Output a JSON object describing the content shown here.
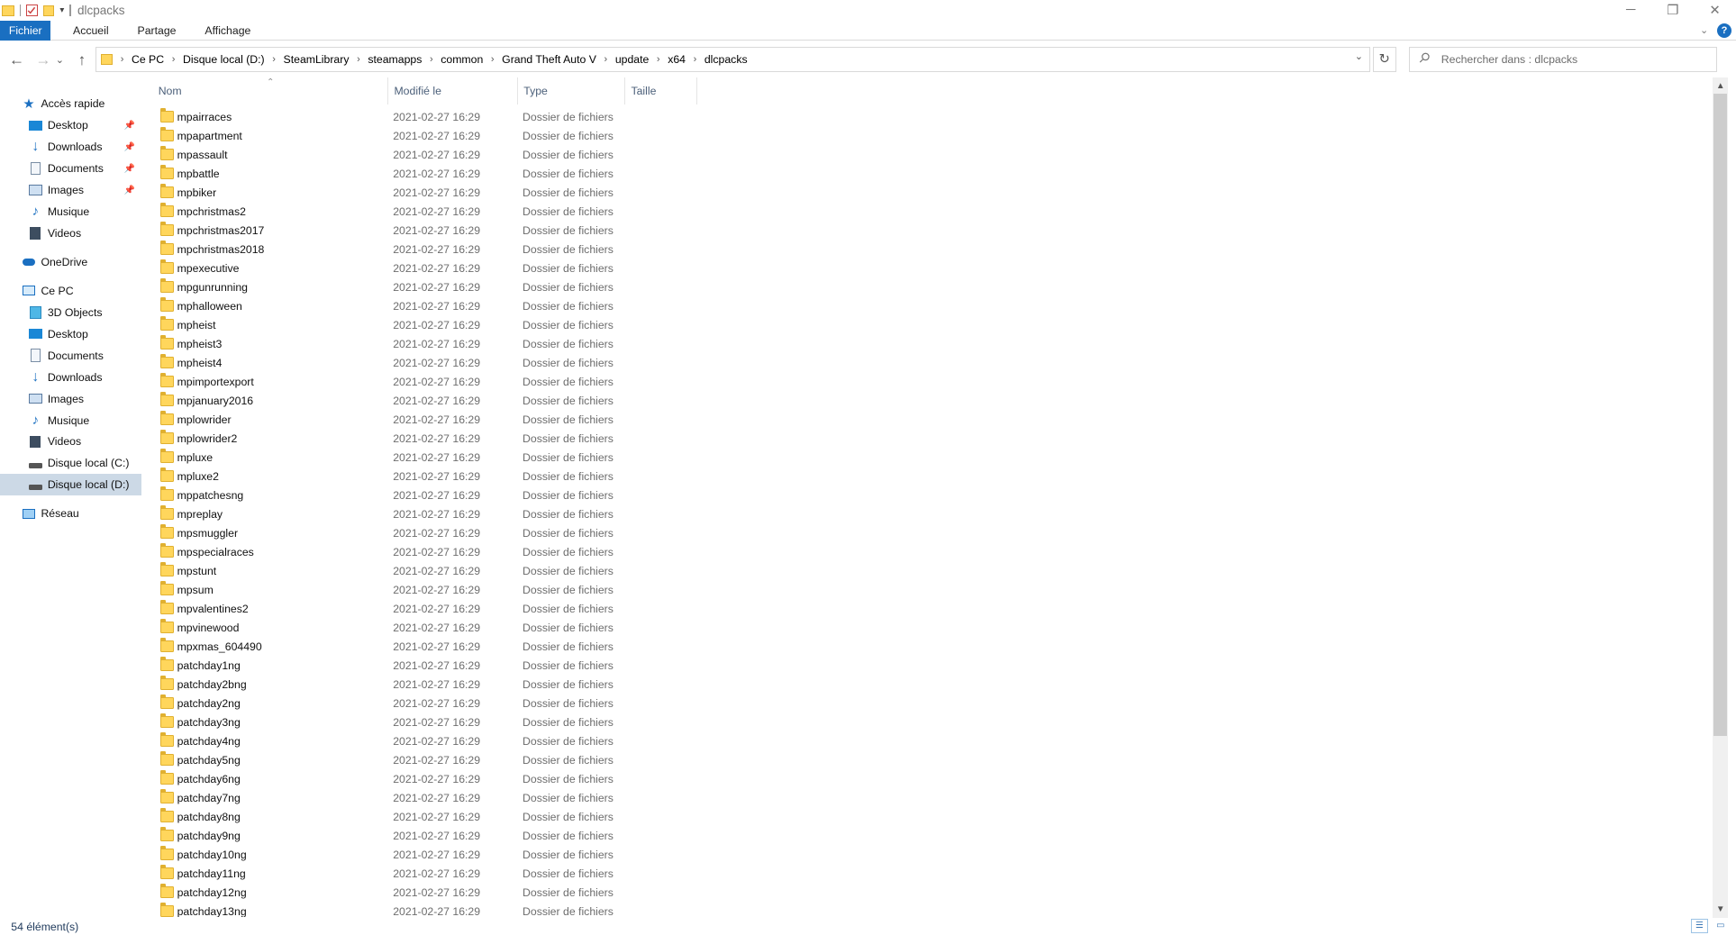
{
  "window": {
    "title": "dlcpacks",
    "minimize_icon": "minimize-icon",
    "maximize_icon": "restore-icon",
    "close_icon": "close-icon"
  },
  "ribbon": {
    "tabs": [
      "Fichier",
      "Accueil",
      "Partage",
      "Affichage"
    ],
    "help": "?"
  },
  "address": {
    "crumbs": [
      "Ce PC",
      "Disque local (D:)",
      "SteamLibrary",
      "steamapps",
      "common",
      "Grand Theft Auto V",
      "update",
      "x64",
      "dlcpacks"
    ]
  },
  "search": {
    "placeholder": "Rechercher dans : dlcpacks"
  },
  "sidebar": {
    "quick_access": "Accès rapide",
    "quick_items": [
      "Desktop",
      "Downloads",
      "Documents",
      "Images",
      "Musique",
      "Videos"
    ],
    "onedrive": "OneDrive",
    "this_pc": "Ce PC",
    "pc_items": [
      "3D Objects",
      "Desktop",
      "Documents",
      "Downloads",
      "Images",
      "Musique",
      "Videos",
      "Disque local (C:)",
      "Disque local (D:)"
    ],
    "network": "Réseau"
  },
  "columns": {
    "name": "Nom",
    "modified": "Modifié le",
    "type": "Type",
    "size": "Taille"
  },
  "file_date": "2021-02-27 16:29",
  "file_type": "Dossier de fichiers",
  "files": [
    "mpairraces",
    "mpapartment",
    "mpassault",
    "mpbattle",
    "mpbiker",
    "mpchristmas2",
    "mpchristmas2017",
    "mpchristmas2018",
    "mpexecutive",
    "mpgunrunning",
    "mphalloween",
    "mpheist",
    "mpheist3",
    "mpheist4",
    "mpimportexport",
    "mpjanuary2016",
    "mplowrider",
    "mplowrider2",
    "mpluxe",
    "mpluxe2",
    "mppatchesng",
    "mpreplay",
    "mpsmuggler",
    "mpspecialraces",
    "mpstunt",
    "mpsum",
    "mpvalentines2",
    "mpvinewood",
    "mpxmas_604490",
    "patchday1ng",
    "patchday2bng",
    "patchday2ng",
    "patchday3ng",
    "patchday4ng",
    "patchday5ng",
    "patchday6ng",
    "patchday7ng",
    "patchday8ng",
    "patchday9ng",
    "patchday10ng",
    "patchday11ng",
    "patchday12ng",
    "patchday13ng"
  ],
  "status": {
    "count": "54 élément(s)"
  },
  "colors": {
    "accent": "#1a6fc1",
    "selected": "#ccd9e6",
    "folder": "#ffd65c"
  }
}
